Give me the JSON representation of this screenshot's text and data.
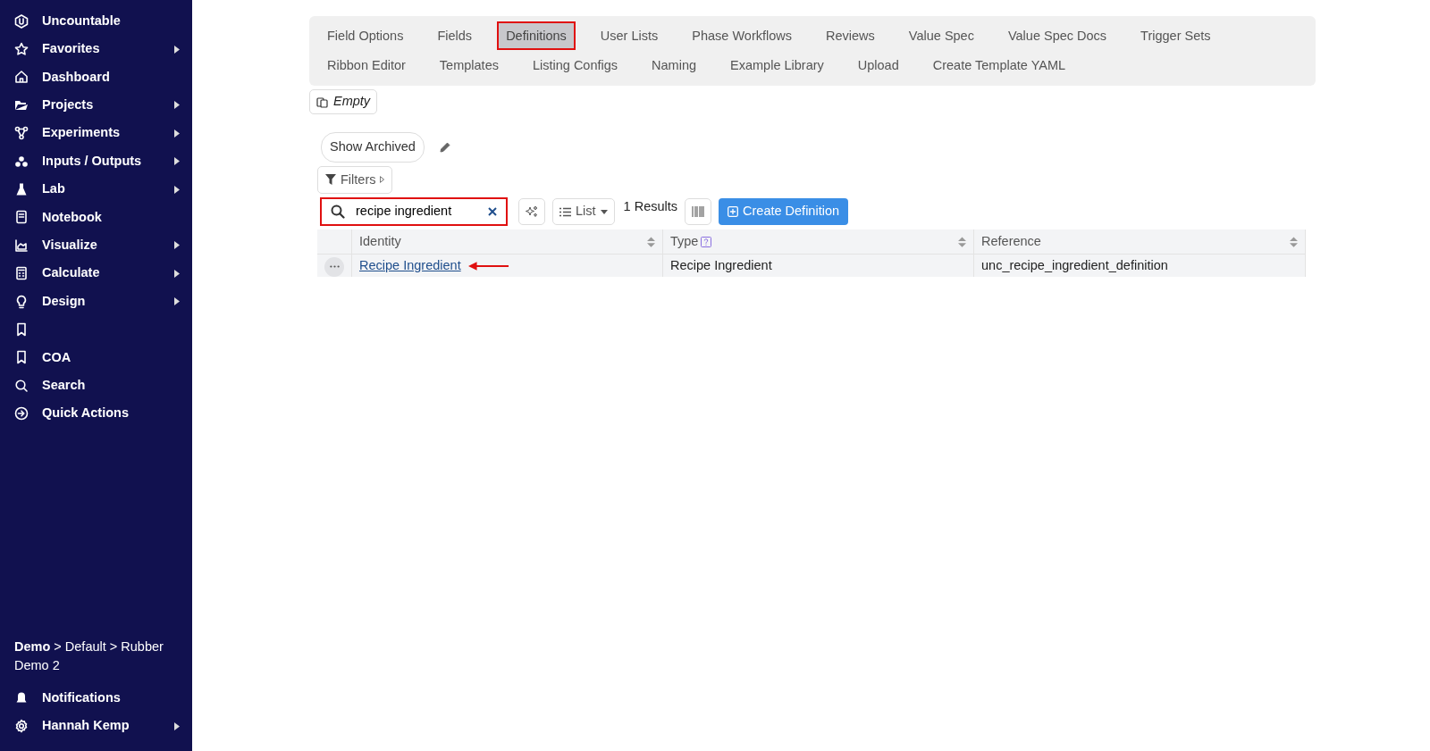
{
  "sidebar": {
    "items": [
      {
        "kind": "link",
        "label": "Uncountable",
        "has_submenu": false
      },
      {
        "kind": "link",
        "label": "Favorites",
        "has_submenu": true
      },
      {
        "kind": "link",
        "label": "Dashboard",
        "has_submenu": false
      },
      {
        "kind": "link",
        "label": "Projects",
        "has_submenu": true
      },
      {
        "kind": "link",
        "label": "Experiments",
        "has_submenu": true
      },
      {
        "kind": "link",
        "label": "Inputs / Outputs",
        "has_submenu": true
      },
      {
        "kind": "link",
        "label": "Lab",
        "has_submenu": true
      },
      {
        "kind": "link",
        "label": "Notebook",
        "has_submenu": false
      },
      {
        "kind": "link",
        "label": "Visualize",
        "has_submenu": true
      },
      {
        "kind": "link",
        "label": "Calculate",
        "has_submenu": true
      },
      {
        "kind": "link",
        "label": "Design",
        "has_submenu": true
      },
      {
        "kind": "icon_only"
      },
      {
        "kind": "link",
        "label": "COA",
        "has_submenu": false
      },
      {
        "kind": "link",
        "label": "Search",
        "has_submenu": false
      },
      {
        "kind": "link",
        "label": "Quick Actions",
        "has_submenu": false
      }
    ],
    "breadcrumb": "**Demo** > Default > Rubber Demo 2",
    "footer_items": [
      {
        "kind": "link",
        "label": "Notifications",
        "has_submenu": false
      },
      {
        "kind": "link",
        "label": "Hannah Kemp",
        "has_submenu": true
      }
    ]
  },
  "tabs": [
    [
      {
        "label": "Field Options",
        "selected": false,
        "highlighted": false
      },
      {
        "label": "Fields",
        "selected": false,
        "highlighted": false
      },
      {
        "label": "Definitions",
        "selected": true,
        "highlighted": true
      },
      {
        "label": "User Lists",
        "selected": false,
        "highlighted": false
      },
      {
        "label": "Phase Workflows",
        "selected": false,
        "highlighted": false
      },
      {
        "label": "Reviews",
        "selected": false,
        "highlighted": false
      },
      {
        "label": "Value Spec",
        "selected": false,
        "highlighted": false
      },
      {
        "label": "Value Spec Docs",
        "selected": false,
        "highlighted": false
      },
      {
        "label": "Trigger Sets",
        "selected": false,
        "highlighted": false
      }
    ],
    [
      {
        "label": "Ribbon Editor",
        "selected": false,
        "highlighted": false
      },
      {
        "label": "Templates",
        "selected": false,
        "highlighted": false
      },
      {
        "label": "Listing Configs",
        "selected": false,
        "highlighted": false
      },
      {
        "label": "Naming",
        "selected": false,
        "highlighted": false
      },
      {
        "label": "Example Library",
        "selected": false,
        "highlighted": false
      },
      {
        "label": "Upload",
        "selected": false,
        "highlighted": false
      },
      {
        "label": "Create Template YAML",
        "selected": false,
        "highlighted": false
      }
    ]
  ],
  "copy_button": "Empty",
  "show_archived": "Show Archived",
  "filters": "Filters",
  "search": {
    "value": "recipe ingredient",
    "highlighted": true
  },
  "view_button": "List",
  "results": "1 Results",
  "create_button": "Create Definition",
  "table": {
    "columns": [
      {
        "label": "Identity",
        "help": false
      },
      {
        "label": "Type",
        "help": true
      },
      {
        "label": "Reference",
        "help": false
      }
    ],
    "rows": [
      {
        "identity": "Recipe Ingredient",
        "type": "Recipe Ingredient",
        "reference": "unc_recipe_ingredient_definition",
        "pointed_at": true
      }
    ]
  }
}
